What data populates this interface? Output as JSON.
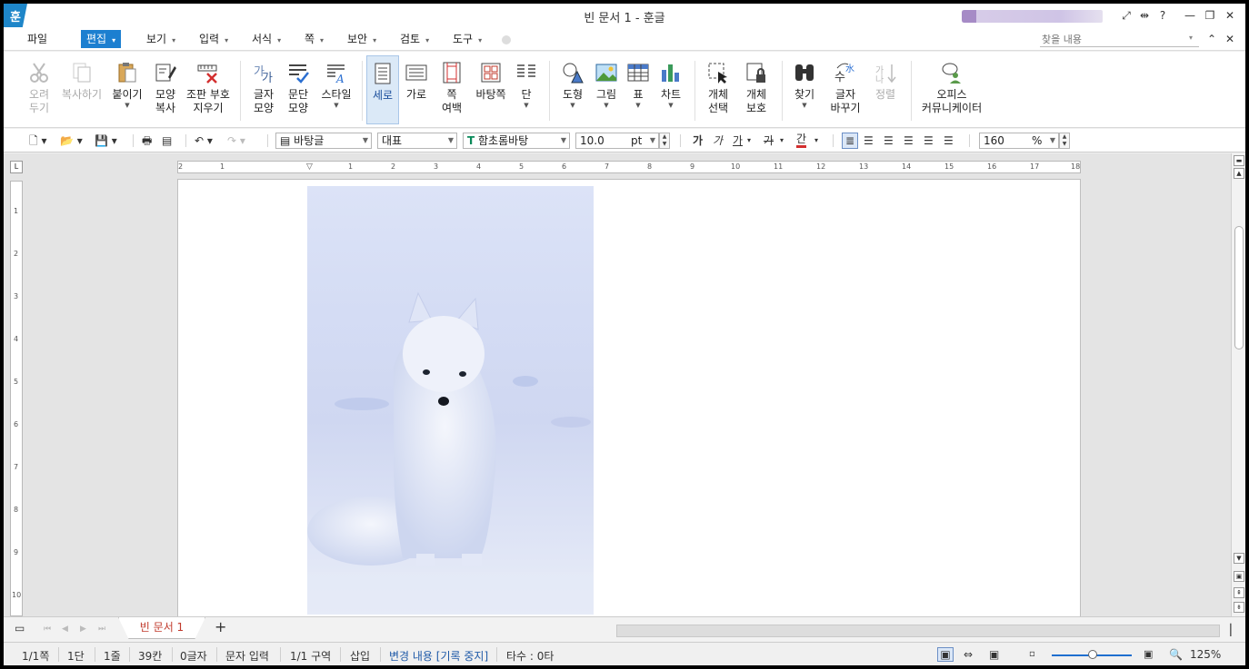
{
  "window": {
    "title": "빈 문서 1 - 훈글",
    "logo_glyph": "훈",
    "controls": [
      "⤢",
      "⇹",
      "?",
      "—",
      "❐",
      "✕"
    ]
  },
  "menu": {
    "items": [
      {
        "label": "파일",
        "arrow": ""
      },
      {
        "label": "편집",
        "arrow": "▾"
      },
      {
        "label": "보기",
        "arrow": "▾"
      },
      {
        "label": "입력",
        "arrow": "▾"
      },
      {
        "label": "서식",
        "arrow": "▾"
      },
      {
        "label": "쪽",
        "arrow": "▾"
      },
      {
        "label": "보안",
        "arrow": "▾"
      },
      {
        "label": "검토",
        "arrow": "▾"
      },
      {
        "label": "도구",
        "arrow": "▾"
      }
    ],
    "active": "편집",
    "search_placeholder": "찾을 내용",
    "right_controls": [
      "⌃",
      "✕"
    ]
  },
  "ribbon": {
    "buttons": [
      {
        "label": "오려\n두기",
        "icon": "scissors-icon",
        "disabled": true
      },
      {
        "label": "복사하기",
        "icon": "copy-icon",
        "disabled": true
      },
      {
        "label": "붙이기",
        "icon": "paste-icon",
        "dropdown": true
      },
      {
        "label": "모양\n복사",
        "icon": "format-painter-icon"
      },
      {
        "label": "조판 부호\n지우기",
        "icon": "clear-codes-icon"
      },
      {
        "label": "글자\n모양",
        "icon": "char-shape-icon"
      },
      {
        "label": "문단\n모양",
        "icon": "para-shape-icon"
      },
      {
        "label": "스타일",
        "icon": "style-icon",
        "dropdown": true
      },
      {
        "label": "세로",
        "icon": "portrait-page-icon",
        "selected": true
      },
      {
        "label": "가로",
        "icon": "landscape-page-icon"
      },
      {
        "label": "쪽\n여백",
        "icon": "page-margin-icon",
        "dropdown": true
      },
      {
        "label": "바탕쪽",
        "icon": "master-page-icon"
      },
      {
        "label": "단",
        "icon": "columns-icon",
        "dropdown": true
      },
      {
        "label": "도형",
        "icon": "shape-icon",
        "dropdown": true
      },
      {
        "label": "그림",
        "icon": "picture-icon",
        "dropdown": true
      },
      {
        "label": "표",
        "icon": "table-icon",
        "dropdown": true
      },
      {
        "label": "차트",
        "icon": "chart-icon",
        "dropdown": true
      },
      {
        "label": "개체\n선택",
        "icon": "object-select-icon",
        "dropdown": true
      },
      {
        "label": "개체\n보호",
        "icon": "object-protect-icon",
        "dropdown": true
      },
      {
        "label": "찾기",
        "icon": "binoculars-icon",
        "dropdown": true
      },
      {
        "label": "글자\n바꾸기",
        "icon": "char-convert-icon",
        "dropdown": true
      },
      {
        "label": "정렬",
        "icon": "sort-icon",
        "disabled": true
      },
      {
        "label": "오피스\n커뮤니케이터",
        "icon": "office-communicator-icon"
      }
    ]
  },
  "format_bar": {
    "style": "바탕글",
    "language": "대표",
    "font": "함초롬바탕",
    "font_icon": "T",
    "size": "10.0",
    "size_unit": "pt",
    "zoom": "160",
    "zoom_unit": "%",
    "char_buttons": [
      "가",
      "가",
      "가",
      "가",
      "간"
    ]
  },
  "ruler": {
    "h_ticks": [
      "2",
      "1",
      "",
      "1",
      "2",
      "3",
      "4",
      "5",
      "6",
      "7",
      "8",
      "9",
      "10",
      "11",
      "12",
      "13",
      "14",
      "15",
      "16",
      "17",
      "18"
    ],
    "v_ticks": [
      "1",
      "2",
      "3",
      "4",
      "5",
      "6",
      "7",
      "8",
      "9",
      "10"
    ],
    "corner": "L"
  },
  "tabs": {
    "document_tab": "빈 문서 1",
    "add_tab": "+"
  },
  "status": {
    "page": "1/1쪽",
    "column": "1단",
    "line": "1줄",
    "cell": "39칸",
    "chars": "0글자",
    "mode": "문자 입력",
    "section": "1/1 구역",
    "insert": "삽입",
    "track": "변경 내용 [기록 중지]",
    "keystrokes": "타수 : 0타",
    "zoom": "125%"
  },
  "colors": {
    "accent": "#1c7fd0",
    "tab_text": "#c0392b",
    "status_link": "#1f5aa8"
  }
}
